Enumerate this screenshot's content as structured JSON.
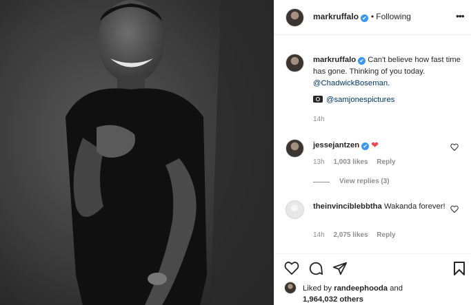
{
  "post": {
    "header": {
      "username": "markruffalo",
      "verified_mark": "✔",
      "separator": "•",
      "follow_status": "Following",
      "more_icon": "more-icon"
    },
    "caption": {
      "username": "markruffalo",
      "text": "Can't believe how fast time has gone. Thinking of you today.",
      "mention": "@ChadwickBoseman.",
      "camera_icon": "camera-icon",
      "credit": "@samjonespictures",
      "time": "14h"
    },
    "comments": [
      {
        "username": "jessejantzen",
        "emoji": "❤",
        "time": "13h",
        "likes": "1,003 likes",
        "reply": "Reply",
        "view_replies": "View replies (3)"
      },
      {
        "username": "theinvinciblebbtha",
        "text": "Wakanda forever!",
        "time": "14h",
        "likes": "2,075 likes",
        "reply": "Reply"
      }
    ],
    "actions": {
      "like_icon": "heart-icon",
      "comment_icon": "comment-icon",
      "share_icon": "share-icon",
      "save_icon": "bookmark-icon"
    },
    "likes": {
      "prefix": "Liked by",
      "user": "randeephooda",
      "joiner": "and",
      "count": "1,964,032 others"
    }
  },
  "colors": {
    "verified": "#3897f0",
    "heart": "#ed4956",
    "muted": "#8e8e8e",
    "link": "#00376b"
  }
}
